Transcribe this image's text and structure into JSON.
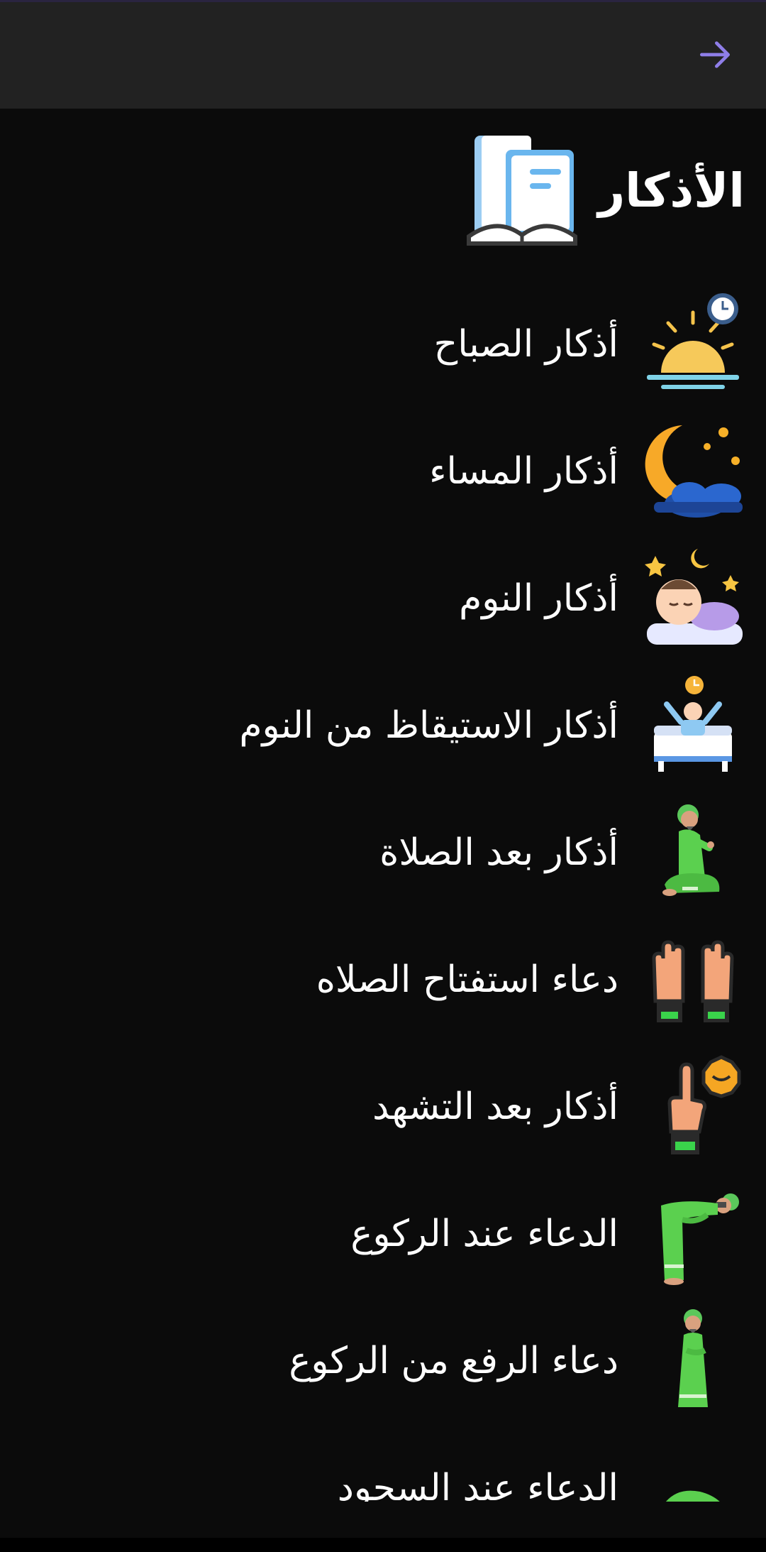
{
  "appbar": {
    "back_icon": "arrow-right-icon",
    "accent": "#8f7ee8"
  },
  "header": {
    "title": "الأذكار",
    "icon": "book-icon"
  },
  "items": [
    {
      "label": "أذكار الصباح",
      "icon": "sunrise-icon"
    },
    {
      "label": "أذكار المساء",
      "icon": "moon-night-icon"
    },
    {
      "label": "أذكار النوم",
      "icon": "sleeping-icon"
    },
    {
      "label": "أذكار الاستيقاظ من النوم",
      "icon": "waking-up-icon"
    },
    {
      "label": "أذكار بعد الصلاة",
      "icon": "sitting-prayer-icon"
    },
    {
      "label": "دعاء استفتاح الصلاه",
      "icon": "raised-hands-icon"
    },
    {
      "label": "أذكار بعد التشهد",
      "icon": "tashahhud-finger-icon"
    },
    {
      "label": "الدعاء عند الركوع",
      "icon": "bowing-icon"
    },
    {
      "label": "دعاء الرفع من الركوع",
      "icon": "standing-prayer-icon"
    },
    {
      "label": "الدعاء عند السجود",
      "icon": "prostration-icon"
    }
  ]
}
